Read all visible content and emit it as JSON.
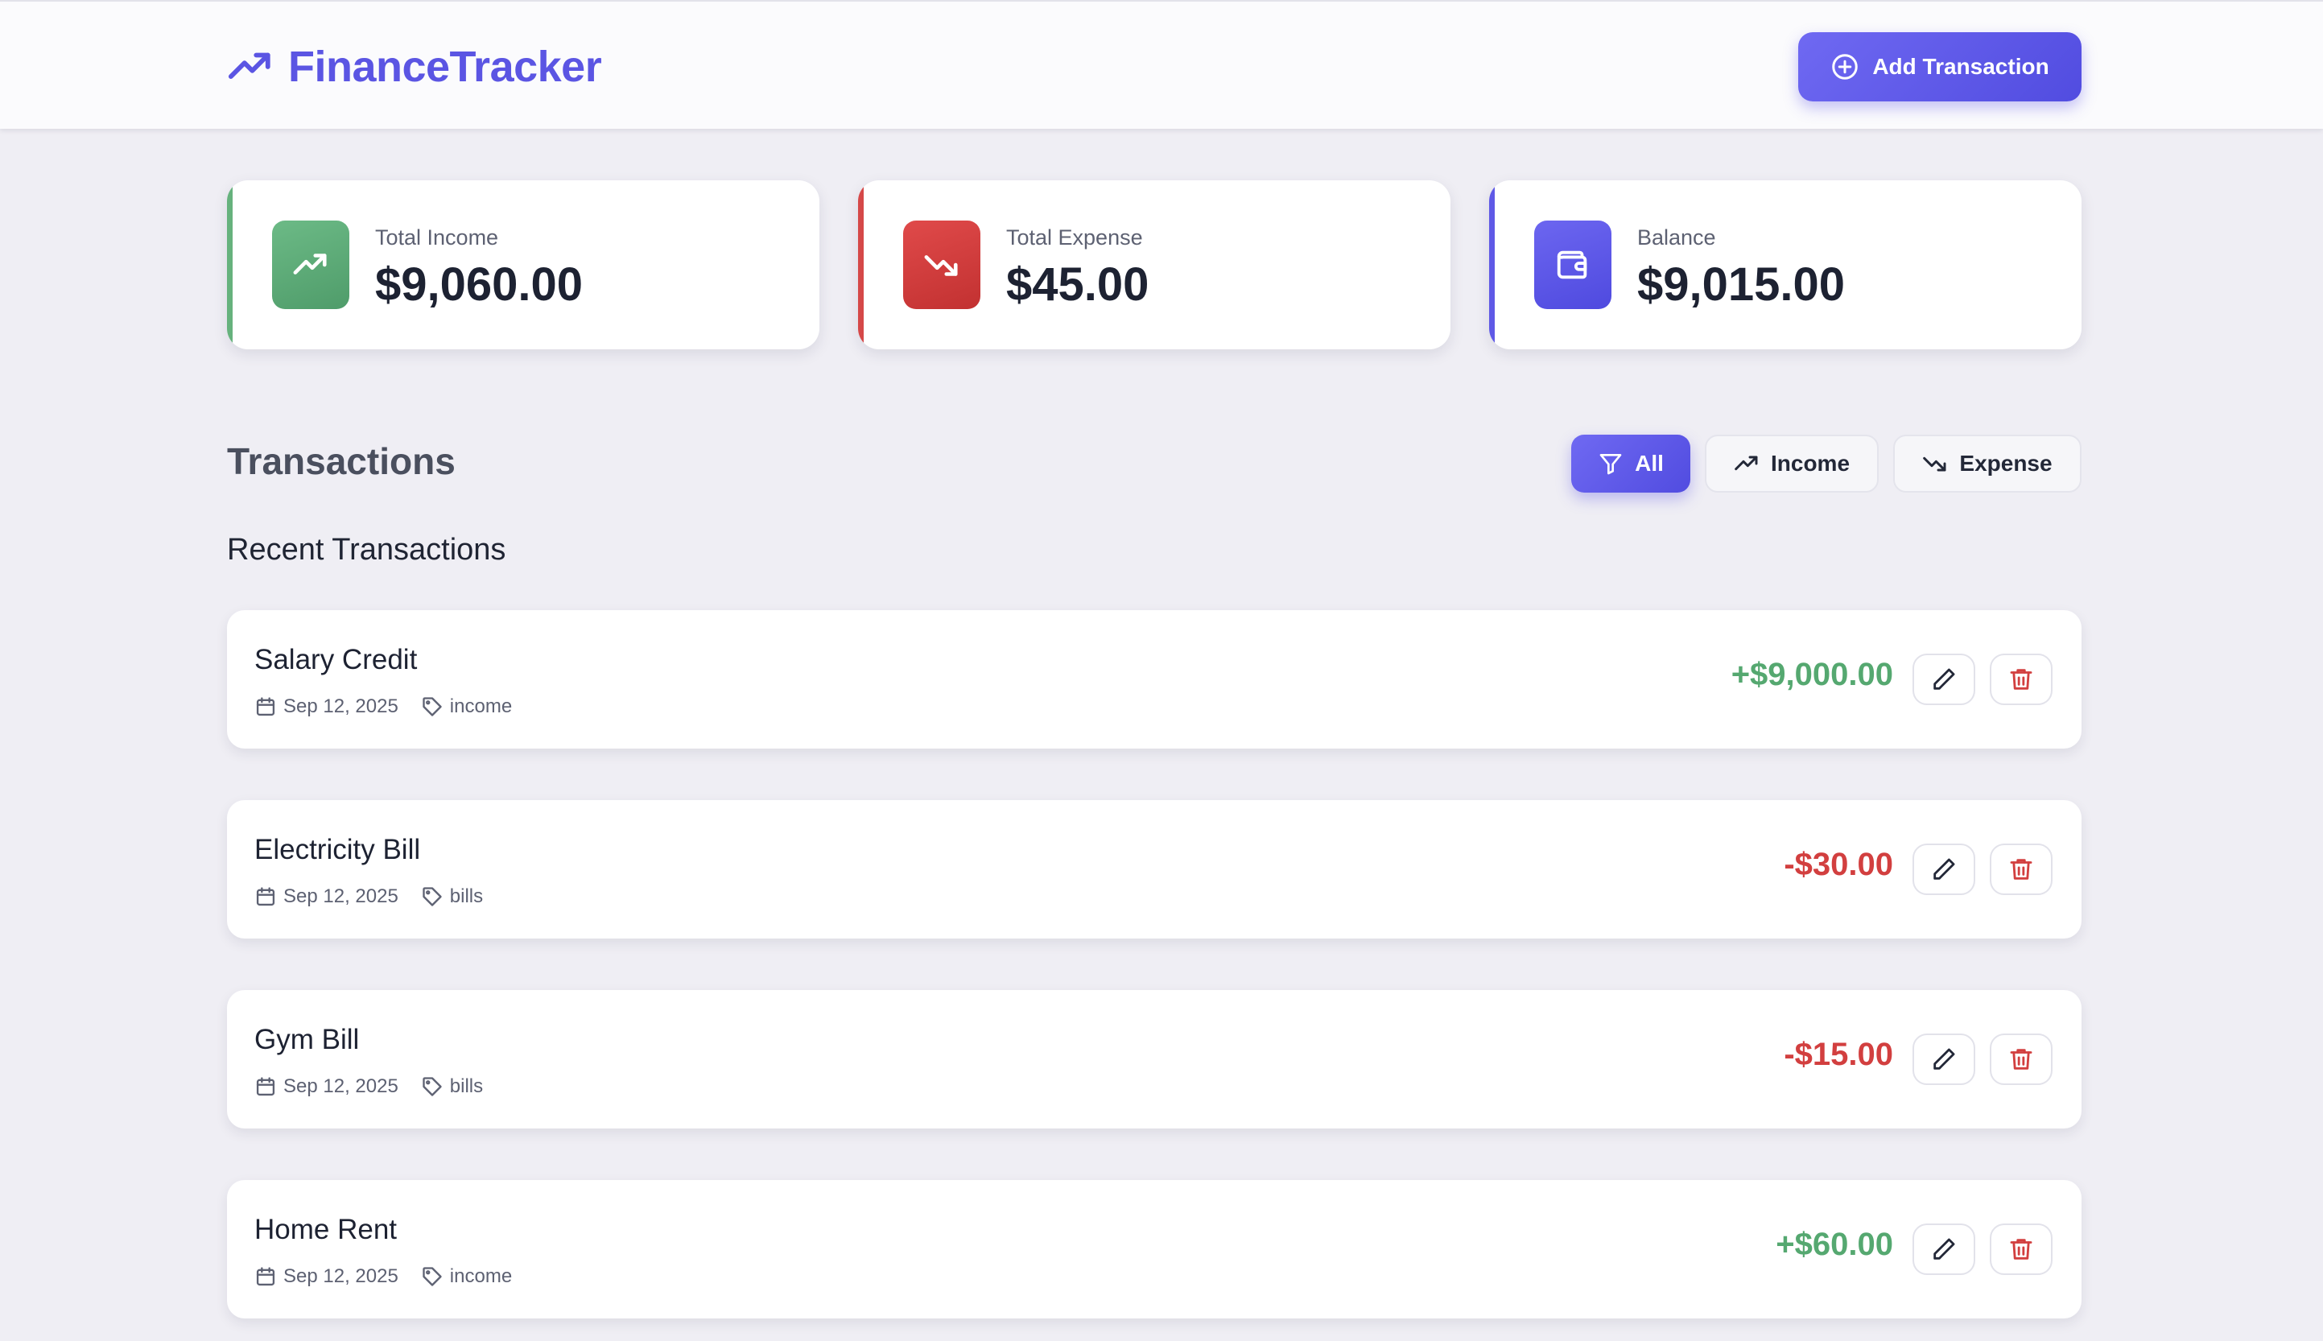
{
  "brand": {
    "title": "FinanceTracker",
    "icon": "trending-up-icon"
  },
  "header": {
    "add_label": "Add Transaction"
  },
  "colors": {
    "accent": "#5b55e3",
    "income": "#55a870",
    "expense": "#d23f3f"
  },
  "summary": {
    "income": {
      "label": "Total Income",
      "value": "$9,060.00"
    },
    "expense": {
      "label": "Total Expense",
      "value": "$45.00"
    },
    "balance": {
      "label": "Balance",
      "value": "$9,015.00"
    }
  },
  "transactions_section": {
    "title": "Transactions",
    "subheading": "Recent Transactions",
    "filters": {
      "all": "All",
      "income": "Income",
      "expense": "Expense"
    },
    "active_filter": "All"
  },
  "transactions": [
    {
      "name": "Salary Credit",
      "date": "Sep 12, 2025",
      "category": "income",
      "amount": "+$9,000.00",
      "type": "income"
    },
    {
      "name": "Electricity Bill",
      "date": "Sep 12, 2025",
      "category": "bills",
      "amount": "-$30.00",
      "type": "expense"
    },
    {
      "name": "Gym Bill",
      "date": "Sep 12, 2025",
      "category": "bills",
      "amount": "-$15.00",
      "type": "expense"
    },
    {
      "name": "Home Rent",
      "date": "Sep 12, 2025",
      "category": "income",
      "amount": "+$60.00",
      "type": "income"
    }
  ]
}
